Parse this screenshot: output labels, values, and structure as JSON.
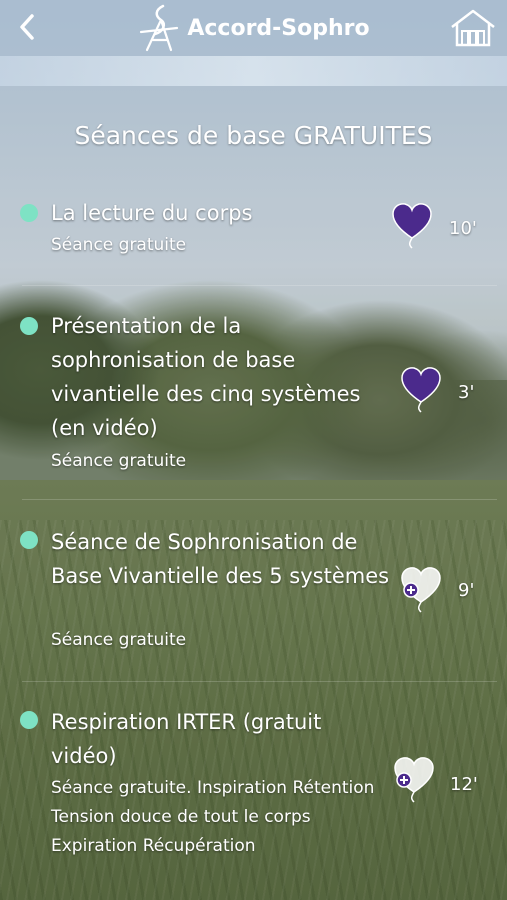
{
  "header": {
    "app_title": "Accord-Sophro",
    "back_icon": "chevron-left-icon",
    "home_icon": "house-icon"
  },
  "page": {
    "title": "Séances de base GRATUITES"
  },
  "colors": {
    "dot": "#7ee2c4",
    "heart_filled": "#4b2a8c",
    "heart_outline": "#ffffff"
  },
  "sessions": [
    {
      "title": "La lecture du corps",
      "subtitle": "Séance gratuite",
      "duration": "10'",
      "icon": "filled-heart-icon"
    },
    {
      "title": "Présentation de la sophronisation de base vivantielle des cinq systèmes (en vidéo)",
      "subtitle": "Séance gratuite",
      "duration": "3'",
      "icon": "filled-heart-icon"
    },
    {
      "title": "Séance de Sophronisation de Base Vivantielle des 5 systèmes",
      "subtitle": "Séance gratuite",
      "duration": "9'",
      "icon": "add-heart-icon"
    },
    {
      "title": "Respiration IRTER (gratuit vidéo)",
      "subtitle": "Séance gratuite. Inspiration Rétention Tension douce de tout le corps Expiration Récupération",
      "duration": "12'",
      "icon": "add-heart-icon"
    }
  ]
}
